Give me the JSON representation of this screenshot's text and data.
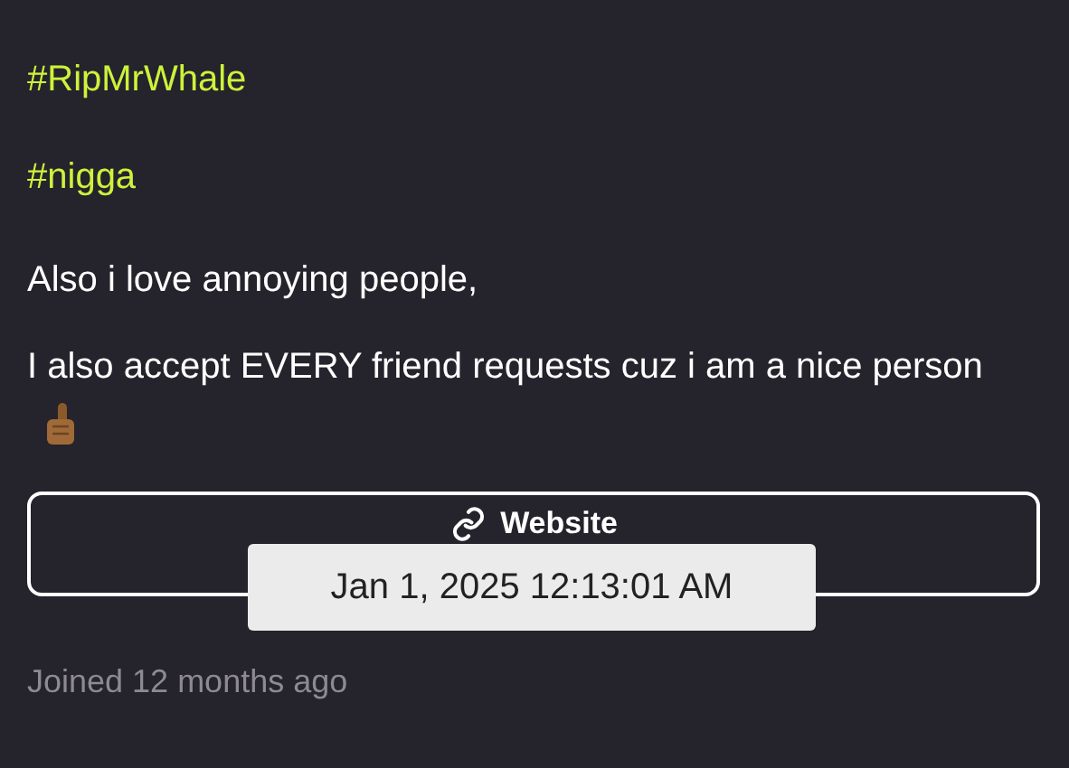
{
  "bio": {
    "hashtags": [
      "#RipMrWhale",
      "#nigga"
    ],
    "paragraphs": [
      "Also i love annoying people,",
      "I also accept EVERY friend requests cuz i am a nice person"
    ]
  },
  "website_button": {
    "label": "Website"
  },
  "tooltip": {
    "text": "Jan 1, 2025 12:13:01 AM"
  },
  "joined": "Joined 12 months ago"
}
